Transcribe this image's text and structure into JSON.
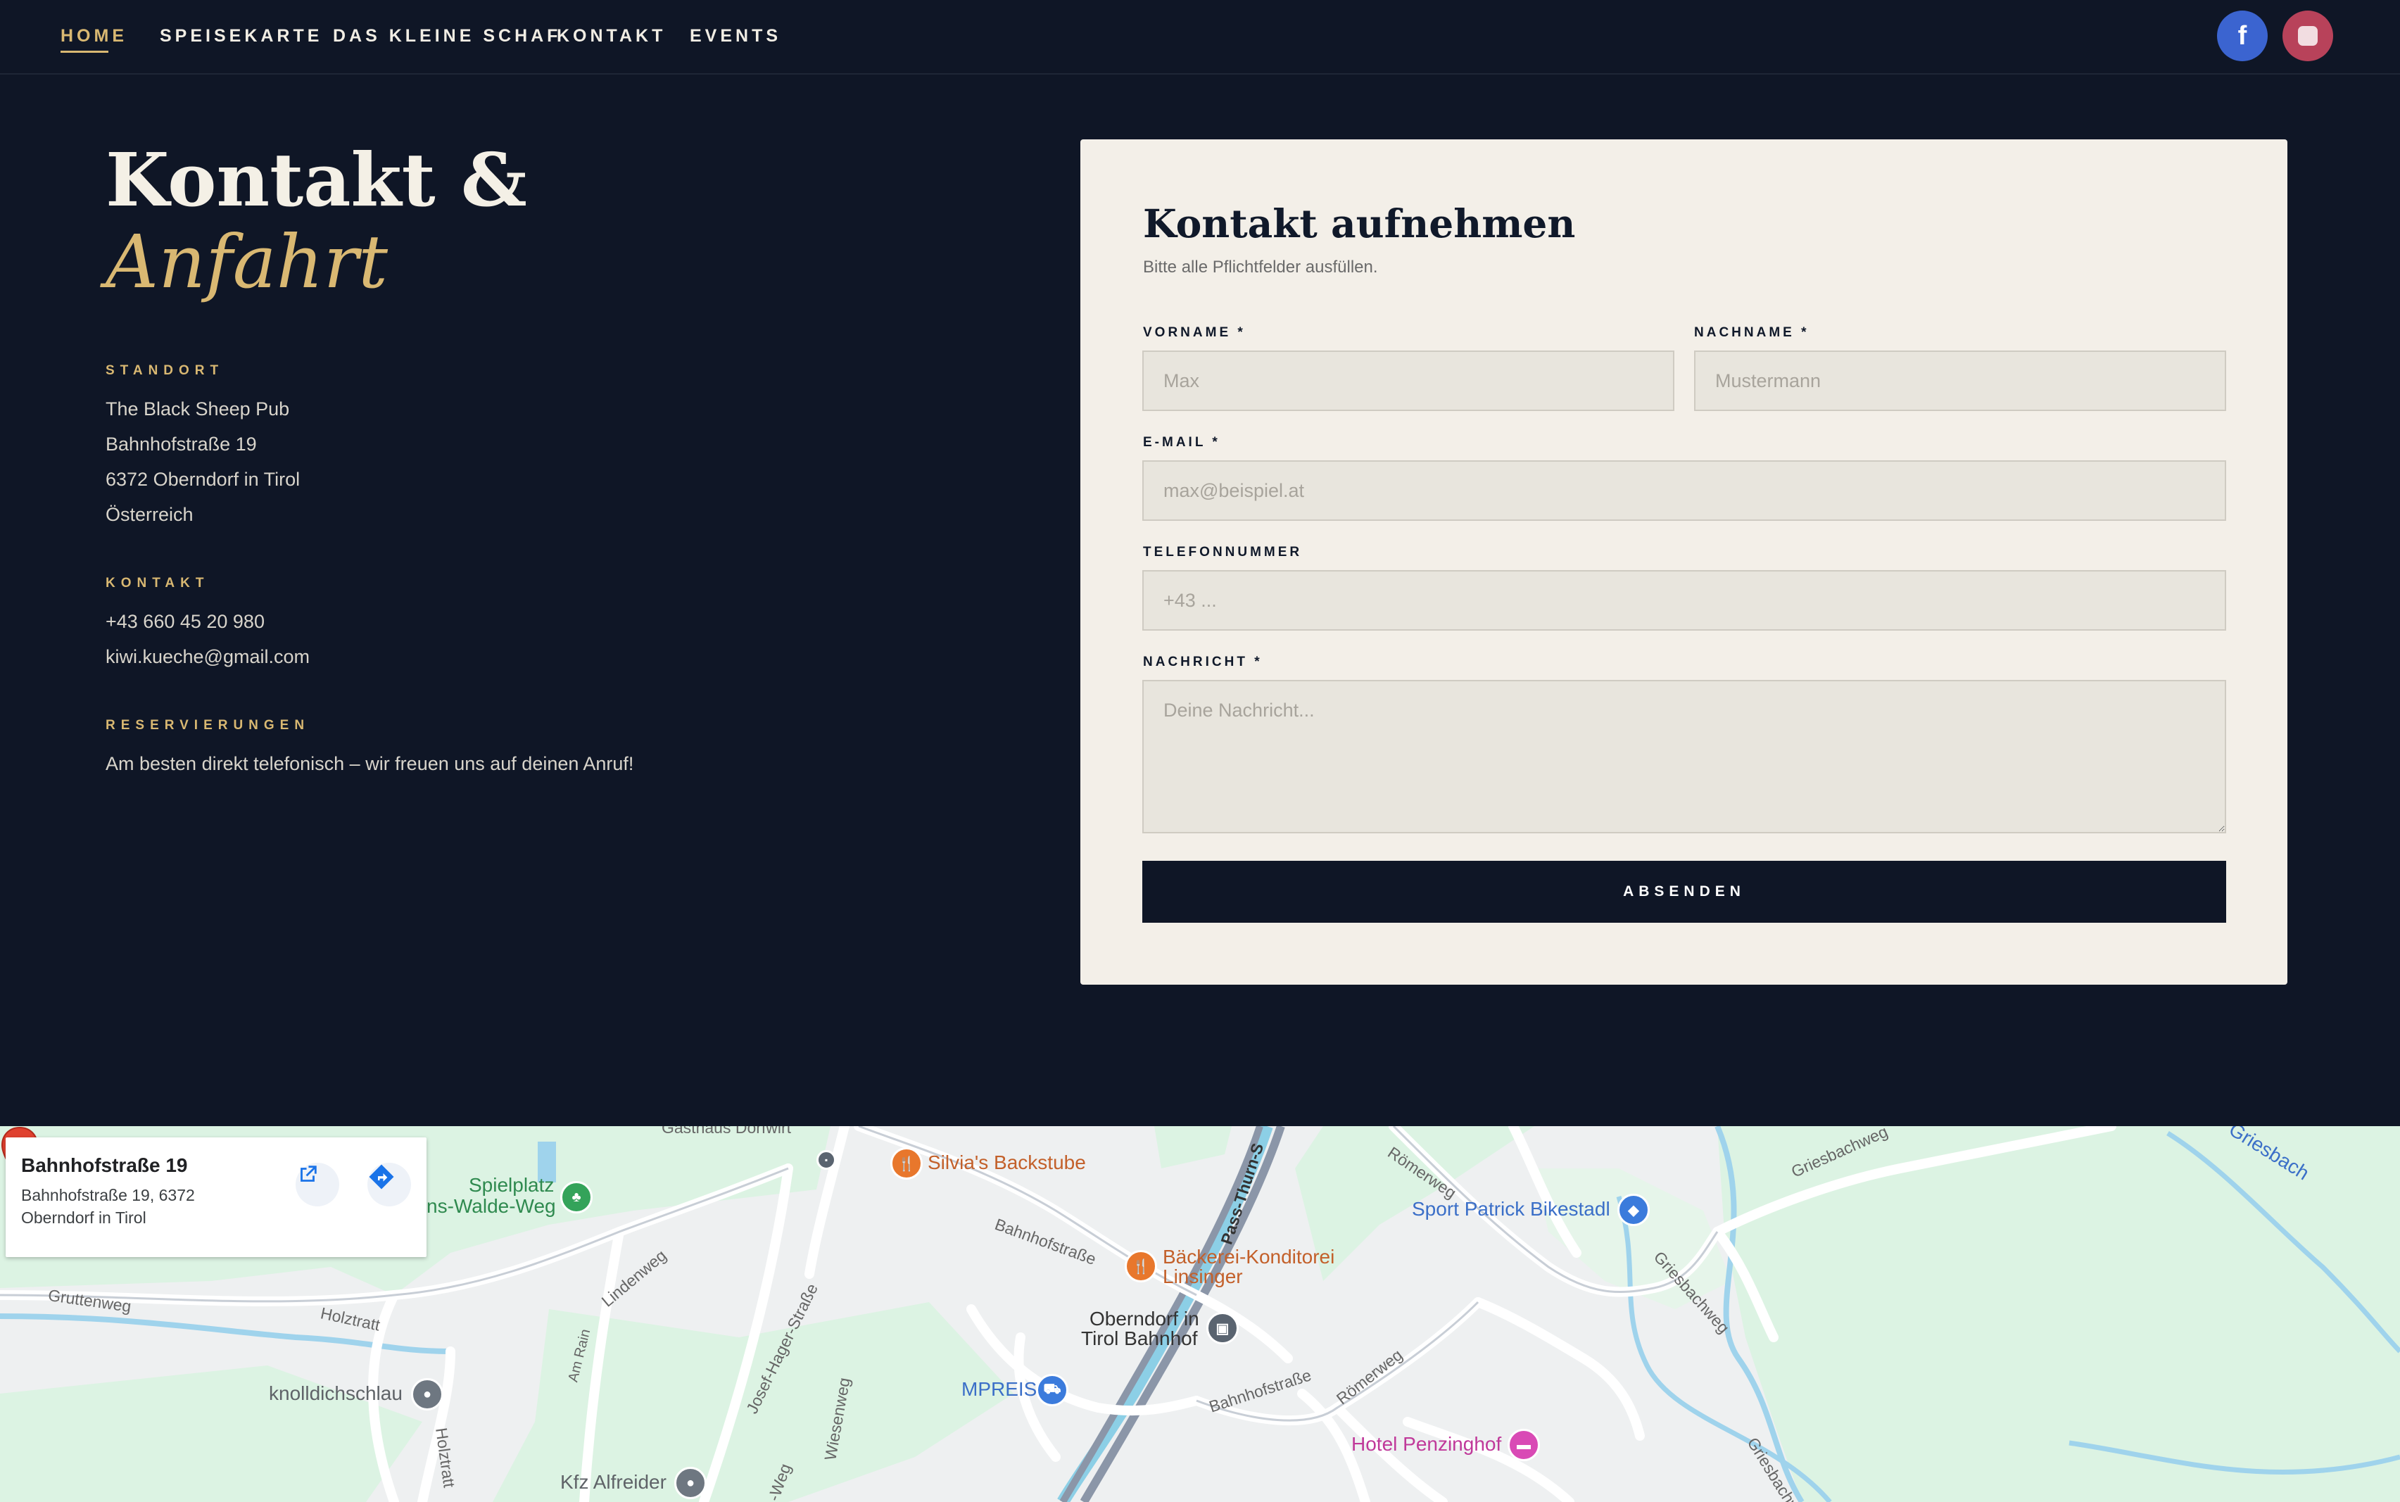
{
  "nav": {
    "items": [
      {
        "label": "HOME"
      },
      {
        "label": "SPEISEKARTE"
      },
      {
        "label": "DAS KLEINE SCHAF"
      },
      {
        "label": "KONTAKT"
      },
      {
        "label": "EVENTS"
      }
    ],
    "social": [
      {
        "icon": "facebook-icon",
        "glyph": "f",
        "color": "#3b64d0"
      },
      {
        "icon": "instagram-icon",
        "color": "#b8425a"
      }
    ]
  },
  "hero": {
    "title_line1": "Kontakt &",
    "title_line2": "Anfahrt"
  },
  "info": {
    "standort": {
      "label": "STANDORT",
      "lines": [
        "The Black Sheep Pub",
        "Bahnhofstraße 19",
        "6372 Oberndorf in Tirol",
        "Österreich"
      ]
    },
    "kontakt": {
      "label": "KONTAKT",
      "phone": "+43 660 45 20 980",
      "email": "kiwi.kueche@gmail.com"
    },
    "reservierungen": {
      "label": "RESERVIERUNGEN",
      "text": "Am besten direkt telefonisch – wir freuen uns auf deinen Anruf!"
    }
  },
  "form": {
    "title": "Kontakt aufnehmen",
    "subtitle": "Bitte alle Pflichtfelder ausfüllen.",
    "vorname": {
      "label": "VORNAME *",
      "placeholder": "Max",
      "value": ""
    },
    "nachname": {
      "label": "NACHNAME *",
      "placeholder": "Mustermann",
      "value": ""
    },
    "email": {
      "label": "E-MAIL *",
      "placeholder": "max@beispiel.at",
      "value": ""
    },
    "telefon": {
      "label": "TELEFONNUMMER",
      "placeholder": "+43 ...",
      "value": ""
    },
    "nachricht": {
      "label": "NACHRICHT *",
      "placeholder": "Deine Nachricht...",
      "value": ""
    },
    "submit_label": "ABSENDEN"
  },
  "map": {
    "place_card": {
      "title": "Bahnhofstraße 19",
      "address": "Bahnhofstraße 19, 6372 Oberndorf in Tirol"
    },
    "labels": {
      "silvias": "Silvia's Backstube",
      "spielplatz": "Spielplatz",
      "walde_weg": "ns-Walde-Weg",
      "baeckerei1": "Bäckerei-Konditorei",
      "baeckerei2": "Linsinger",
      "bahnhof1": "Oberndorf in",
      "bahnhof2": "Tirol Bahnhof",
      "mpreis": "MPREIS",
      "sport": "Sport Patrick Bikestadl",
      "hotel": "Hotel Penzinghof",
      "knolldich": "knolldichschlau",
      "kfz": "Kfz Alfreider",
      "griesbach": "Griesbach",
      "s_bahnhofstrasse": "Bahnhofstraße",
      "s_bahnhofstrasse2": "Bahnhofstraße",
      "s_pass": "Pass-Thurn-S",
      "s_roemerweg": "Römerweg",
      "s_roemerweg2": "Römerweg",
      "s_griesbachweg": "Griesbachweg",
      "s_griesbachweg2": "Griesbachweg",
      "s_griesbachweg3": "Griesbachw",
      "s_lindenweg": "Lindenweg",
      "s_josef": "Josef-Hager-Straße",
      "s_holztratt": "Holztratt",
      "s_holztratt2": "Holztratt",
      "s_gruttenweg": "Gruttenweg",
      "s_amrain": "Am Rain",
      "s_wiesenweg": "Wiesenweg",
      "s_weg": "-Weg",
      "s_top": "Gasthaus Dorfwirt"
    }
  }
}
